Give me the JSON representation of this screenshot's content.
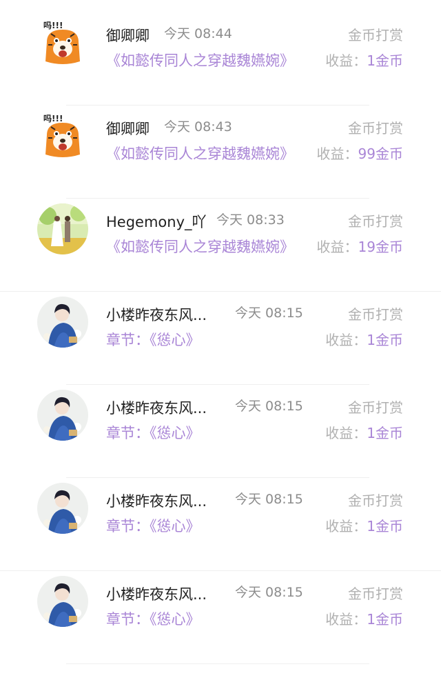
{
  "colors": {
    "accent_purple": "#a985d6",
    "name_text": "#222222",
    "muted_text": "#8c8c8c",
    "action_text": "#b0b0b0"
  },
  "items": [
    {
      "avatar": "tiger-sticker-avatar",
      "name": "御卿卿",
      "time": "今天 08:44",
      "action": "金币打赏",
      "subtitle": "《如懿传同人之穿越魏嬿婉》",
      "earnings_label": "收益：",
      "earnings_value": "1金币"
    },
    {
      "avatar": "tiger-sticker-avatar",
      "name": "御卿卿",
      "time": "今天 08:43",
      "action": "金币打赏",
      "subtitle": "《如懿传同人之穿越魏嬿婉》",
      "earnings_label": "收益：",
      "earnings_value": "99金币"
    },
    {
      "avatar": "couple-photo-avatar",
      "name": "Hegemony_吖",
      "time": "今天 08:33",
      "action": "金币打赏",
      "subtitle": "《如懿传同人之穿越魏嬿婉》",
      "earnings_label": "收益：",
      "earnings_value": "19金币"
    },
    {
      "avatar": "illustrated-man-avatar",
      "name": "小楼昨夜东风...",
      "time": "今天 08:15",
      "action": "金币打赏",
      "subtitle": "章节：《慫心》",
      "earnings_label": "收益：",
      "earnings_value": "1金币"
    },
    {
      "avatar": "illustrated-man-avatar",
      "name": "小楼昨夜东风...",
      "time": "今天 08:15",
      "action": "金币打赏",
      "subtitle": "章节：《慫心》",
      "earnings_label": "收益：",
      "earnings_value": "1金币"
    },
    {
      "avatar": "illustrated-man-avatar",
      "name": "小楼昨夜东风...",
      "time": "今天 08:15",
      "action": "金币打赏",
      "subtitle": "章节：《慫心》",
      "earnings_label": "收益：",
      "earnings_value": "1金币"
    },
    {
      "avatar": "illustrated-man-avatar",
      "name": "小楼昨夜东风...",
      "time": "今天 08:15",
      "action": "金币打赏",
      "subtitle": "章节：《慫心》",
      "earnings_label": "收益：",
      "earnings_value": "1金币"
    }
  ]
}
